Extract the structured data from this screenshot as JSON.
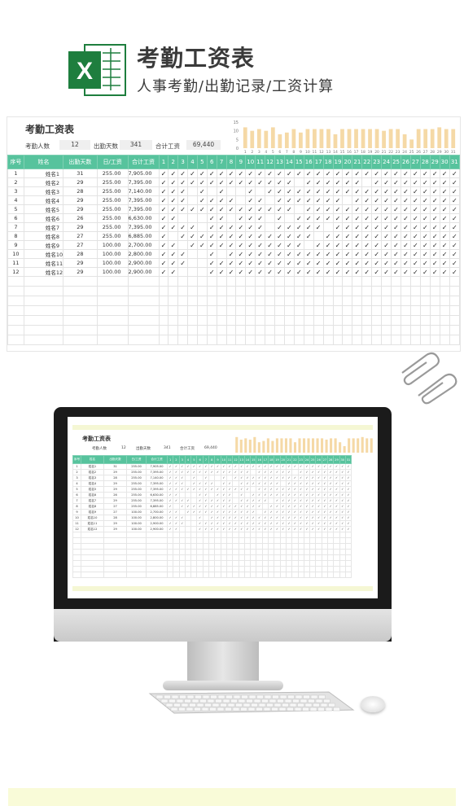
{
  "header": {
    "title": "考勤工资表",
    "subtitle": "人事考勤/出勤记录/工资计算",
    "logo_letter": "X"
  },
  "sheet": {
    "title": "考勤工资表",
    "summary": {
      "headcount_label": "考勤人数",
      "headcount_value": "12",
      "days_label": "出勤天数",
      "days_value": "341",
      "total_label": "合计工资",
      "total_value": "69,440"
    },
    "columns": [
      "序号",
      "姓名",
      "出勤天数",
      "日/工资",
      "合计工资"
    ],
    "day_columns": [
      "1",
      "2",
      "3",
      "4",
      "5",
      "6",
      "7",
      "8",
      "9",
      "10",
      "11",
      "12",
      "13",
      "14",
      "15",
      "16",
      "17",
      "18",
      "19",
      "20",
      "21",
      "22",
      "23",
      "24",
      "25",
      "26",
      "27",
      "28",
      "29",
      "30",
      "31"
    ],
    "check_mark": "✓",
    "rows": [
      {
        "no": "1",
        "name": "姓名1",
        "days": "31",
        "rate": "255.00",
        "total": "7,905.00",
        "marks": "1111111111111111111111111111111"
      },
      {
        "no": "2",
        "name": "姓名2",
        "days": "29",
        "rate": "255.00",
        "total": "7,395.00",
        "marks": "1111111111111101111110111111111"
      },
      {
        "no": "3",
        "name": "姓名3",
        "days": "28",
        "rate": "255.00",
        "total": "7,140.00",
        "marks": "1110101001011111111111111111111"
      },
      {
        "no": "4",
        "name": "姓名4",
        "days": "29",
        "rate": "255.00",
        "total": "7,395.00",
        "marks": "1110111101101111111011111111111"
      },
      {
        "no": "5",
        "name": "姓名5",
        "days": "29",
        "rate": "255.00",
        "total": "7,395.00",
        "marks": "1111111111111101111111111111111"
      },
      {
        "no": "6",
        "name": "姓名6",
        "days": "26",
        "rate": "255.00",
        "total": "6,630.00",
        "marks": "1100011011101011111111111111111"
      },
      {
        "no": "7",
        "name": "姓名7",
        "days": "29",
        "rate": "255.00",
        "total": "7,395.00",
        "marks": "1111011111101111101111111111111"
      },
      {
        "no": "8",
        "name": "姓名8",
        "days": "27",
        "rate": "255.00",
        "total": "6,885.00",
        "marks": "1011111111111111011111111111111"
      },
      {
        "no": "9",
        "name": "姓名9",
        "days": "27",
        "rate": "100.00",
        "total": "2,700.00",
        "marks": "1101111111111110111111111111111"
      },
      {
        "no": "10",
        "name": "姓名10",
        "days": "28",
        "rate": "100.00",
        "total": "2,800.00",
        "marks": "1110010111111111111111111111111"
      },
      {
        "no": "11",
        "name": "姓名11",
        "days": "29",
        "rate": "100.00",
        "total": "2,900.00",
        "marks": "1110011111111111111111111111111"
      },
      {
        "no": "12",
        "name": "姓名12",
        "days": "29",
        "rate": "100.00",
        "total": "2,900.00",
        "marks": "1100011111111111111111111111111"
      }
    ]
  },
  "chart_data": {
    "type": "bar",
    "categories": [
      "1",
      "2",
      "3",
      "4",
      "5",
      "6",
      "7",
      "8",
      "9",
      "10",
      "11",
      "12",
      "13",
      "14",
      "15",
      "16",
      "17",
      "18",
      "19",
      "20",
      "21",
      "22",
      "23",
      "24",
      "25",
      "26",
      "27",
      "28",
      "29",
      "30",
      "31"
    ],
    "values": [
      12,
      10,
      11,
      10,
      12,
      8,
      9,
      11,
      9,
      11,
      11,
      11,
      11,
      8,
      11,
      11,
      11,
      11,
      11,
      11,
      10,
      11,
      11,
      8,
      5,
      11,
      11,
      11,
      12,
      11,
      11
    ],
    "ylim": [
      0,
      15
    ],
    "yticks": [
      "15",
      "10",
      "5",
      "0"
    ],
    "bar_color": "#f5d9a6"
  },
  "colors": {
    "header_green": "#57c39d",
    "band_yellow": "#f9fbd8",
    "excel_green": "#1e7e3e"
  },
  "icons": {
    "logo": "excel-icon",
    "clips": "paperclip-icon",
    "monitor": "monitor-icon",
    "keyboard": "keyboard-icon",
    "mouse": "mouse-icon"
  }
}
